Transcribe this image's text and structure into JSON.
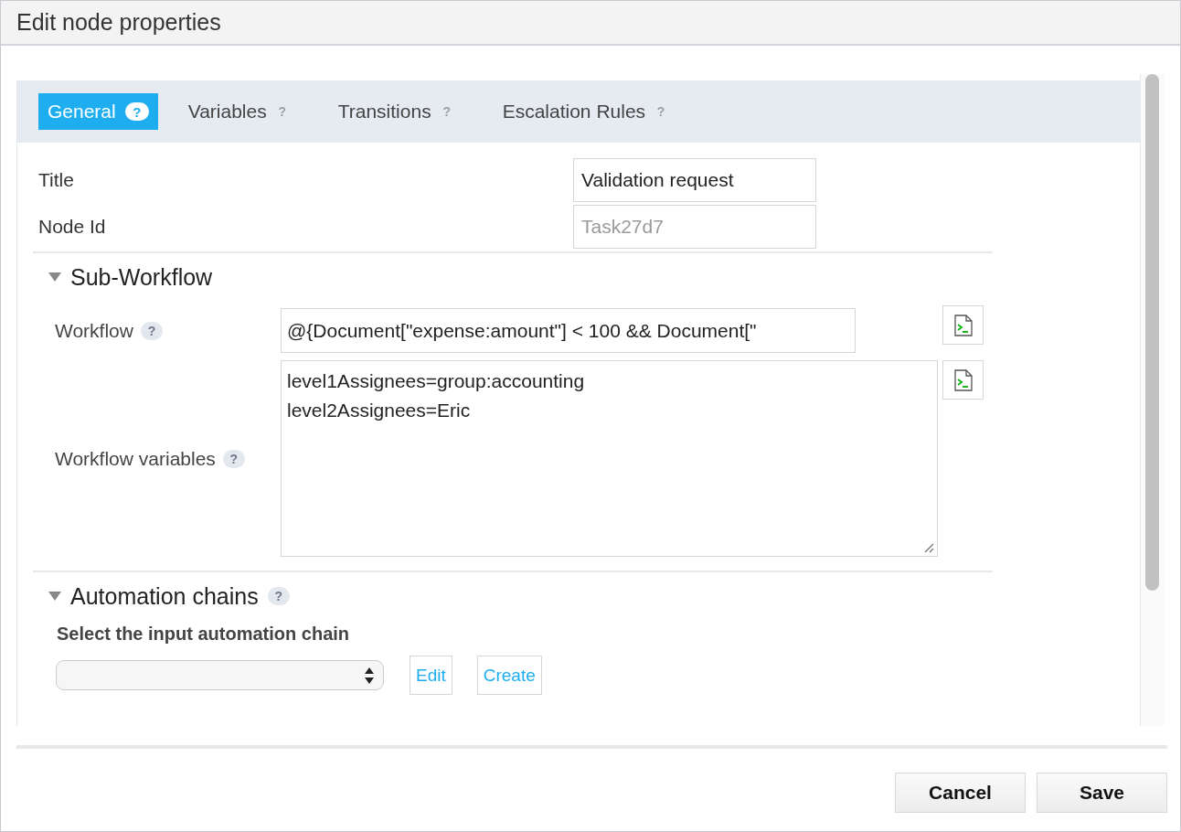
{
  "window": {
    "title": "Edit node properties"
  },
  "tabs": [
    {
      "label": "General",
      "help": "?",
      "selected": true
    },
    {
      "label": "Variables",
      "help": "?",
      "selected": false
    },
    {
      "label": "Transitions",
      "help": "?",
      "selected": false
    },
    {
      "label": "Escalation Rules",
      "help": "?",
      "selected": false
    }
  ],
  "fields": [
    {
      "label": "Title",
      "value": "Validation request",
      "disabled": false
    },
    {
      "label": "Node Id",
      "value": "Task27d7",
      "disabled": true
    }
  ],
  "sections": [
    {
      "title": "Sub-Workflow",
      "expanded": true,
      "rows": [
        {
          "kind": "input",
          "label": "Workflow",
          "help": "?",
          "value": "@{Document[\"expense:amount\"] < 100 && Document[\""
        },
        {
          "kind": "textarea",
          "label": "Workflow variables",
          "help": "?",
          "value": "level1Assignees=group:accounting\nlevel2Assignees=Eric"
        }
      ]
    },
    {
      "title": "Automation chains",
      "help": "?",
      "expanded": true,
      "rows": [
        {
          "kind": "select",
          "label": "Select the input automation chain",
          "buttons": [
            "Edit",
            "Create"
          ]
        }
      ]
    }
  ],
  "buttons": [
    "Cancel",
    "Save"
  ]
}
